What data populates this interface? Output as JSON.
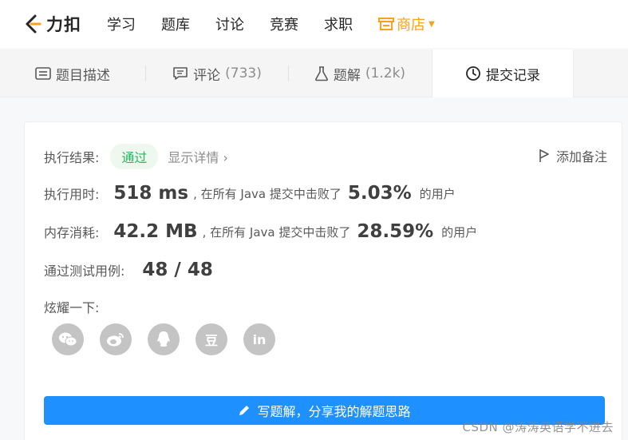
{
  "nav": {
    "brand": "力扣",
    "items": [
      "学习",
      "题库",
      "讨论",
      "竞赛",
      "求职"
    ],
    "store": "商店"
  },
  "tabs": [
    {
      "label": "题目描述",
      "count": ""
    },
    {
      "label": "评论",
      "count": "(733)"
    },
    {
      "label": "题解",
      "count": "(1.2k)"
    },
    {
      "label": "提交记录",
      "count": ""
    }
  ],
  "result": {
    "label": "执行结果:",
    "status": "通过",
    "detail_link": "显示详情 ›",
    "add_note": "添加备注"
  },
  "runtime": {
    "label": "执行用时:",
    "value": "518 ms",
    "mid": ", 在所有 Java 提交中击败了",
    "pct": "5.03%",
    "suffix": "的用户"
  },
  "memory": {
    "label": "内存消耗:",
    "value": "42.2 MB",
    "mid": ", 在所有 Java 提交中击败了",
    "pct": "28.59%",
    "suffix": "的用户"
  },
  "tests": {
    "label": "通过测试用例:",
    "value": "48 / 48"
  },
  "share": {
    "label": "炫耀一下:",
    "buttons": [
      "wechat-icon",
      "weibo-icon",
      "qq-icon",
      "douban-icon",
      "linkedin-icon"
    ],
    "douban_glyph": "豆",
    "linkedin_glyph": "in"
  },
  "write_button": "写题解，分享我的解题思路",
  "watermark": "CSDN @涛涛英语学不进去",
  "colors": {
    "accent": "#ffa116",
    "success": "#2db55d",
    "primary": "#1e90ff"
  }
}
